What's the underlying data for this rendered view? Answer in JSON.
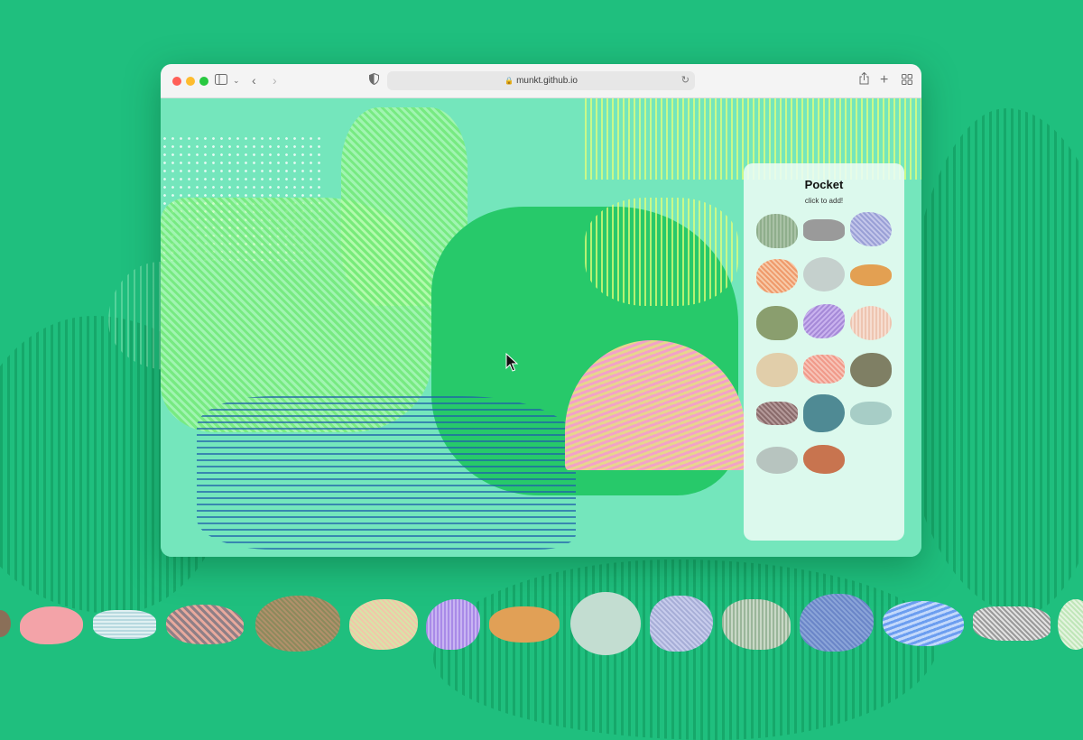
{
  "browser": {
    "url": "munkt.github.io",
    "icons": {
      "sidebar": "sidebar-icon",
      "back": "chevron-left-icon",
      "forward": "chevron-right-icon",
      "shield": "shield-icon",
      "lock": "lock-icon",
      "reload": "reload-icon",
      "share": "share-icon",
      "new_tab": "plus-icon",
      "tabs": "tab-grid-icon"
    }
  },
  "pocket": {
    "title": "Pocket",
    "subtitle": "click to add!"
  },
  "colors": {
    "background": "#1fbf7e",
    "canvas": "#74e6bc",
    "panel": "#ebfcf4"
  }
}
